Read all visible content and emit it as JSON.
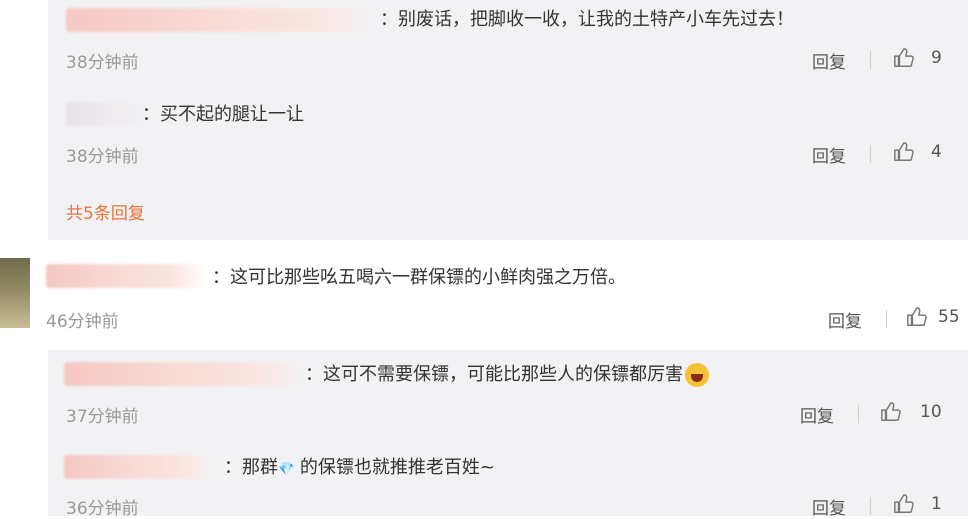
{
  "comments": {
    "reply_a": {
      "text": "：别废话，把脚收一收，让我的土特产小车先过去！",
      "time": "38分钟前",
      "reply_label": "回复",
      "likes": "9"
    },
    "reply_b": {
      "text": "：买不起的腿让一让",
      "time": "38分钟前",
      "reply_label": "回复",
      "likes": "4"
    },
    "more_replies": "共5条回复",
    "main": {
      "text": "：这可比那些吆五喝六一群保镖的小鲜肉强之万倍。",
      "time": "46分钟前",
      "reply_label": "回复",
      "likes": "55"
    },
    "reply_c": {
      "text": "：这可不需要保镖，可能比那些人的保镖都厉害",
      "time": "37分钟前",
      "reply_label": "回复",
      "likes": "10"
    },
    "reply_d": {
      "text_before": "：那群",
      "gem": "💎",
      "text_after": " 的保镖也就推推老百姓~",
      "time": "36分钟前",
      "reply_label": "回复",
      "likes": "1"
    }
  },
  "icons": {
    "like": "thumbs-up-icon",
    "emoji": "laughing-emoji-icon"
  },
  "colors": {
    "more_link": "#e8723a",
    "panel_bg": "#f2f2f5"
  }
}
